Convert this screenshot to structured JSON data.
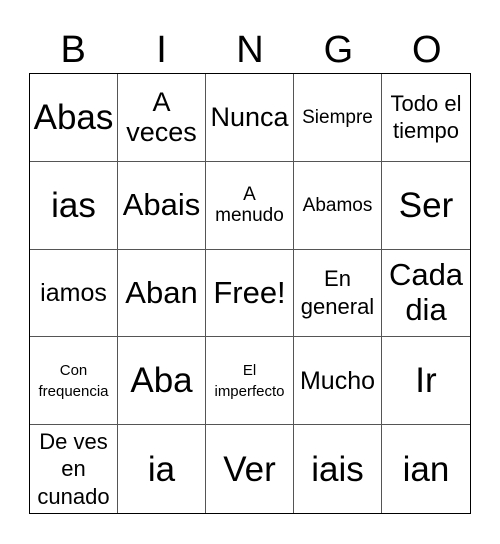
{
  "title_letters": [
    "B",
    "I",
    "N",
    "G",
    "O"
  ],
  "cells": [
    [
      "Abas",
      "A veces",
      "Nunca",
      "Siempre",
      "Todo el tiempo"
    ],
    [
      "ias",
      "Abais",
      "A menudo",
      "Abamos",
      "Ser"
    ],
    [
      "iamos",
      "Aban",
      "Free!",
      "En general",
      "Cada dia"
    ],
    [
      "Con frequencia",
      "Aba",
      "El imperfecto",
      "Mucho",
      "Ir"
    ],
    [
      "De ves en cunado",
      "ia",
      "Ver",
      "iais",
      "ian"
    ]
  ],
  "free_space": {
    "row": 2,
    "col": 2,
    "label": "Free!"
  }
}
